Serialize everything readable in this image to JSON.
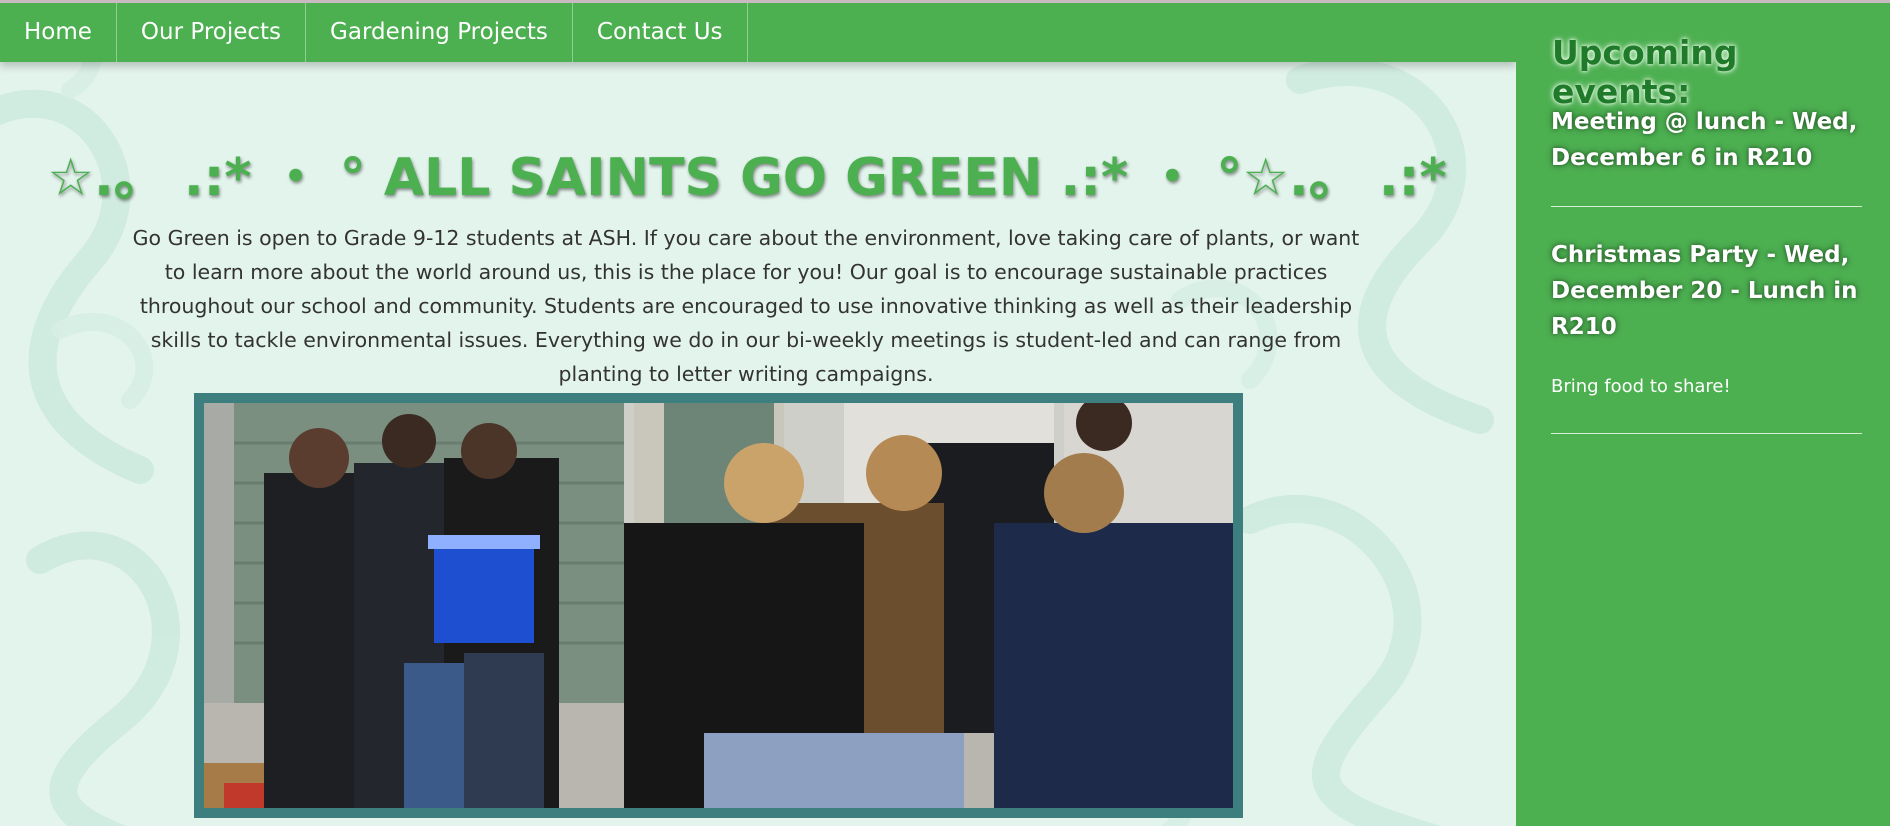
{
  "nav": {
    "items": [
      {
        "label": "Home"
      },
      {
        "label": "Our Projects"
      },
      {
        "label": "Gardening Projects"
      },
      {
        "label": "Contact Us"
      }
    ]
  },
  "main": {
    "title": "☆.。 .:* ・ ° ALL SAINTS GO GREEN .:* ・ °☆.。 .:*",
    "intro": "Go Green is open to Grade 9-12 students at ASH. If you care about the environment, love taking care of plants, or want to learn more about the world around us, this is the place for you! Our goal is to encourage sustainable practices throughout our school and community. Students are encouraged to use innovative thinking as well as their leadership skills to tackle environmental issues. Everything we do in our bi-weekly meetings is student-led and can range from planting to letter writing campaigns."
  },
  "sidebar": {
    "title": "Upcoming events:",
    "events": [
      {
        "heading": "Meeting @ lunch - Wed, December 6 in R210"
      },
      {
        "heading": "Christmas Party - Wed, December 20 - Lunch in R210",
        "note": "Bring food to share!"
      }
    ]
  },
  "colors": {
    "brand_green": "#4caf50",
    "frame_teal": "#3d7f7f",
    "background_mint": "#e3f4ec"
  }
}
